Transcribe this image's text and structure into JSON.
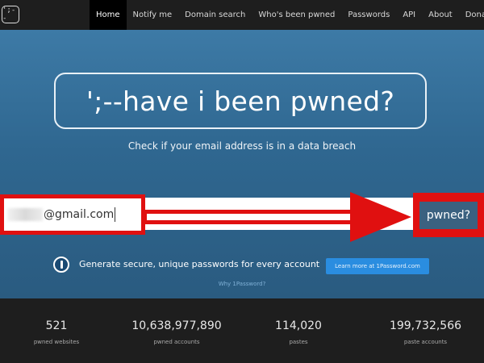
{
  "navbar": {
    "logo_text": "';--",
    "items": [
      {
        "label": "Home",
        "active": true
      },
      {
        "label": "Notify me",
        "active": false
      },
      {
        "label": "Domain search",
        "active": false
      },
      {
        "label": "Who's been pwned",
        "active": false
      },
      {
        "label": "Passwords",
        "active": false
      },
      {
        "label": "API",
        "active": false
      },
      {
        "label": "About",
        "active": false
      },
      {
        "label": "Donate",
        "active": false
      }
    ],
    "donate_icon": "bitcoin-icon"
  },
  "hero": {
    "title": "';--have i been pwned?",
    "subtitle": "Check if your email address is in a data breach"
  },
  "search": {
    "email_value": "@gmail.com",
    "button_label": "pwned?"
  },
  "promo": {
    "icon": "1password-icon",
    "text": "Generate secure, unique passwords for every account",
    "button_label": "Learn more at 1Password.com",
    "link_text": "Why 1Password?"
  },
  "stats": [
    {
      "value": "521",
      "label": "pwned websites"
    },
    {
      "value": "10,638,977,890",
      "label": "pwned accounts"
    },
    {
      "value": "114,020",
      "label": "pastes"
    },
    {
      "value": "199,732,566",
      "label": "paste accounts"
    }
  ],
  "colors": {
    "navbar_bg": "#1e1e1e",
    "hero_bg": "#2f6790",
    "annotation_red": "#e01010",
    "button_bg": "#3b6180",
    "promo_button_bg": "#2a8de0"
  }
}
